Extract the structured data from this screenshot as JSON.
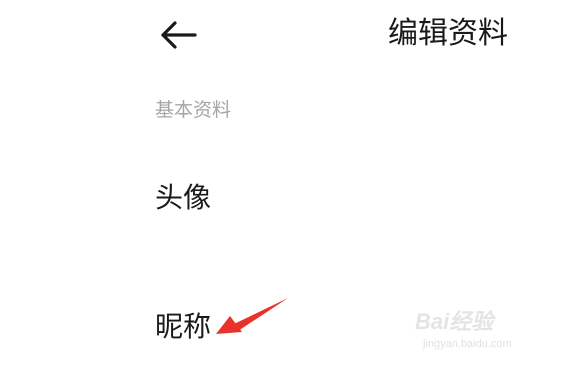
{
  "header": {
    "back_icon": "arrow-left-icon",
    "title": "编辑资料"
  },
  "section": {
    "title": "基本资料"
  },
  "rows": [
    {
      "label": "头像"
    },
    {
      "label": "昵称"
    }
  ],
  "annotation": {
    "icon": "red-arrow-icon",
    "color": "#e8322b"
  },
  "watermark": {
    "brand": "Bai经验",
    "url": "jingyan.baidu.com"
  },
  "colors": {
    "text_primary": "#1a1a1a",
    "text_secondary": "#a6a6a6",
    "background": "#ffffff"
  }
}
